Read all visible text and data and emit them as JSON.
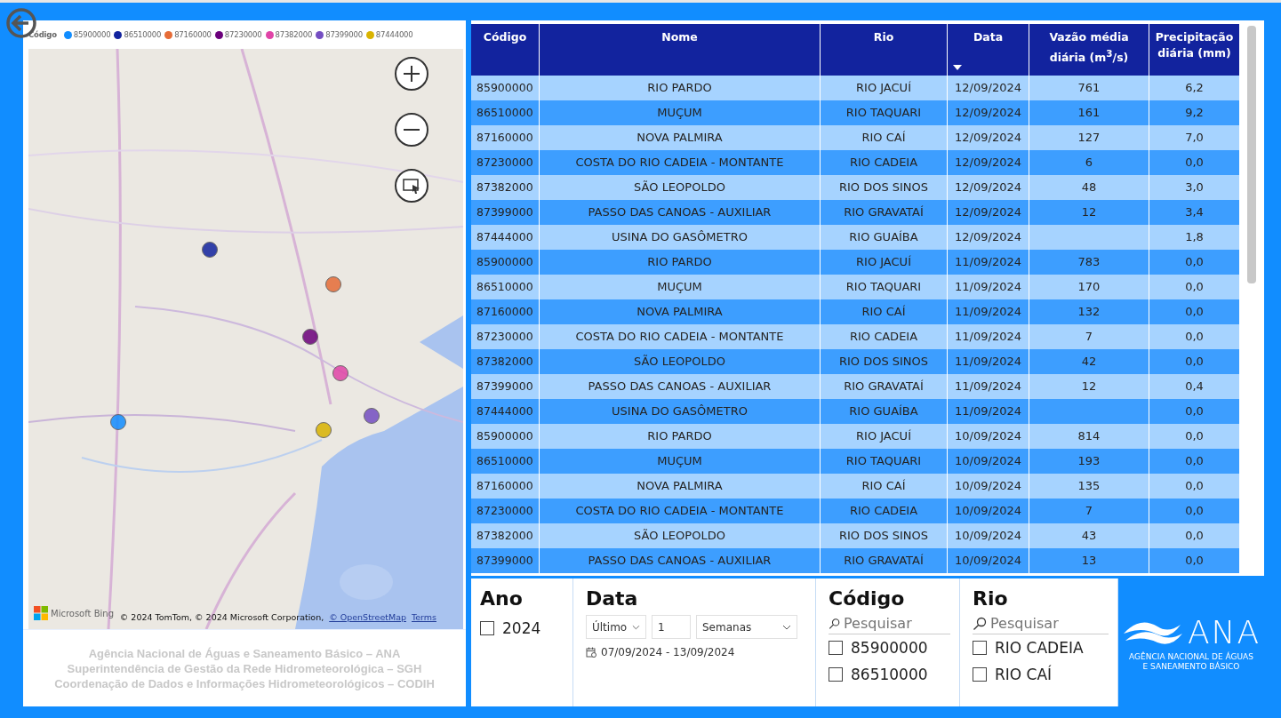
{
  "legend": {
    "title": "Código",
    "items": [
      {
        "label": "85900000",
        "color": "#118dff"
      },
      {
        "label": "86510000",
        "color": "#12239e"
      },
      {
        "label": "87160000",
        "color": "#e66c37"
      },
      {
        "label": "87230000",
        "color": "#6b007b"
      },
      {
        "label": "87382000",
        "color": "#e044a7"
      },
      {
        "label": "87399000",
        "color": "#744ec2"
      },
      {
        "label": "87444000",
        "color": "#d9b300"
      }
    ]
  },
  "map": {
    "brand": "Microsoft Bing",
    "attribution": "© 2024 TomTom, © 2024 Microsoft Corporation,",
    "osm_link": "© OpenStreetMap",
    "terms_link": "Terms"
  },
  "footer": [
    "Agência Nacional de Águas e Saneamento Básico – ANA",
    "Superintendência de Gestão da Rede Hidrometeorológica – SGH",
    "Coordenação de Dados e Informações Hidrometeorológicos – CODIH"
  ],
  "table": {
    "columns": [
      {
        "label": "Código",
        "sorted": false
      },
      {
        "label": "Nome",
        "sorted": false
      },
      {
        "label": "Rio",
        "sorted": false
      },
      {
        "label": "Data",
        "sorted": true
      },
      {
        "label": "Vazão média diária (m$^{3}$/s)",
        "sorted": false
      },
      {
        "label": "Precipitação diária (mm)",
        "sorted": false
      }
    ],
    "rows": [
      [
        "85900000",
        "RIO PARDO",
        "RIO JACUÍ",
        "12/09/2024",
        "761",
        "6,2"
      ],
      [
        "86510000",
        "MUÇUM",
        "RIO TAQUARI",
        "12/09/2024",
        "161",
        "9,2"
      ],
      [
        "87160000",
        "NOVA PALMIRA",
        "RIO CAÍ",
        "12/09/2024",
        "127",
        "7,0"
      ],
      [
        "87230000",
        "COSTA DO RIO CADEIA - MONTANTE",
        "RIO CADEIA",
        "12/09/2024",
        "6",
        "0,0"
      ],
      [
        "87382000",
        "SÃO LEOPOLDO",
        "RIO DOS SINOS",
        "12/09/2024",
        "48",
        "3,0"
      ],
      [
        "87399000",
        "PASSO DAS CANOAS - AUXILIAR",
        "RIO GRAVATAÍ",
        "12/09/2024",
        "12",
        "3,4"
      ],
      [
        "87444000",
        "USINA DO GASÔMETRO",
        "RIO GUAÍBA",
        "12/09/2024",
        "",
        "1,8"
      ],
      [
        "85900000",
        "RIO PARDO",
        "RIO JACUÍ",
        "11/09/2024",
        "783",
        "0,0"
      ],
      [
        "86510000",
        "MUÇUM",
        "RIO TAQUARI",
        "11/09/2024",
        "170",
        "0,0"
      ],
      [
        "87160000",
        "NOVA PALMIRA",
        "RIO CAÍ",
        "11/09/2024",
        "132",
        "0,0"
      ],
      [
        "87230000",
        "COSTA DO RIO CADEIA - MONTANTE",
        "RIO CADEIA",
        "11/09/2024",
        "7",
        "0,0"
      ],
      [
        "87382000",
        "SÃO LEOPOLDO",
        "RIO DOS SINOS",
        "11/09/2024",
        "42",
        "0,0"
      ],
      [
        "87399000",
        "PASSO DAS CANOAS - AUXILIAR",
        "RIO GRAVATAÍ",
        "11/09/2024",
        "12",
        "0,4"
      ],
      [
        "87444000",
        "USINA DO GASÔMETRO",
        "RIO GUAÍBA",
        "11/09/2024",
        "",
        "0,0"
      ],
      [
        "85900000",
        "RIO PARDO",
        "RIO JACUÍ",
        "10/09/2024",
        "814",
        "0,0"
      ],
      [
        "86510000",
        "MUÇUM",
        "RIO TAQUARI",
        "10/09/2024",
        "193",
        "0,0"
      ],
      [
        "87160000",
        "NOVA PALMIRA",
        "RIO CAÍ",
        "10/09/2024",
        "135",
        "0,0"
      ],
      [
        "87230000",
        "COSTA DO RIO CADEIA - MONTANTE",
        "RIO CADEIA",
        "10/09/2024",
        "7",
        "0,0"
      ],
      [
        "87382000",
        "SÃO LEOPOLDO",
        "RIO DOS SINOS",
        "10/09/2024",
        "43",
        "0,0"
      ],
      [
        "87399000",
        "PASSO DAS CANOAS - AUXILIAR",
        "RIO GRAVATAÍ",
        "10/09/2024",
        "13",
        "0,0"
      ]
    ]
  },
  "slicers": {
    "ano": {
      "title": "Ano",
      "items": [
        {
          "label": "2024",
          "checked": false
        }
      ]
    },
    "data": {
      "title": "Data",
      "mode": "Último",
      "count": "1",
      "unit": "Semanas",
      "range": "07/09/2024 - 13/09/2024"
    },
    "codigo": {
      "title": "Código",
      "placeholder": "Pesquisar",
      "items": [
        {
          "label": "85900000",
          "checked": false
        },
        {
          "label": "86510000",
          "checked": false
        }
      ]
    },
    "rio": {
      "title": "Rio",
      "placeholder": "Pesquisar",
      "items": [
        {
          "label": "RIO CADEIA",
          "checked": false
        },
        {
          "label": "RIO CAÍ",
          "checked": false
        }
      ]
    }
  },
  "logo": {
    "name": "ANA",
    "line1": "AGÊNCIA NACIONAL DE ÁGUAS",
    "line2": "E SANEAMENTO BÁSICO"
  }
}
